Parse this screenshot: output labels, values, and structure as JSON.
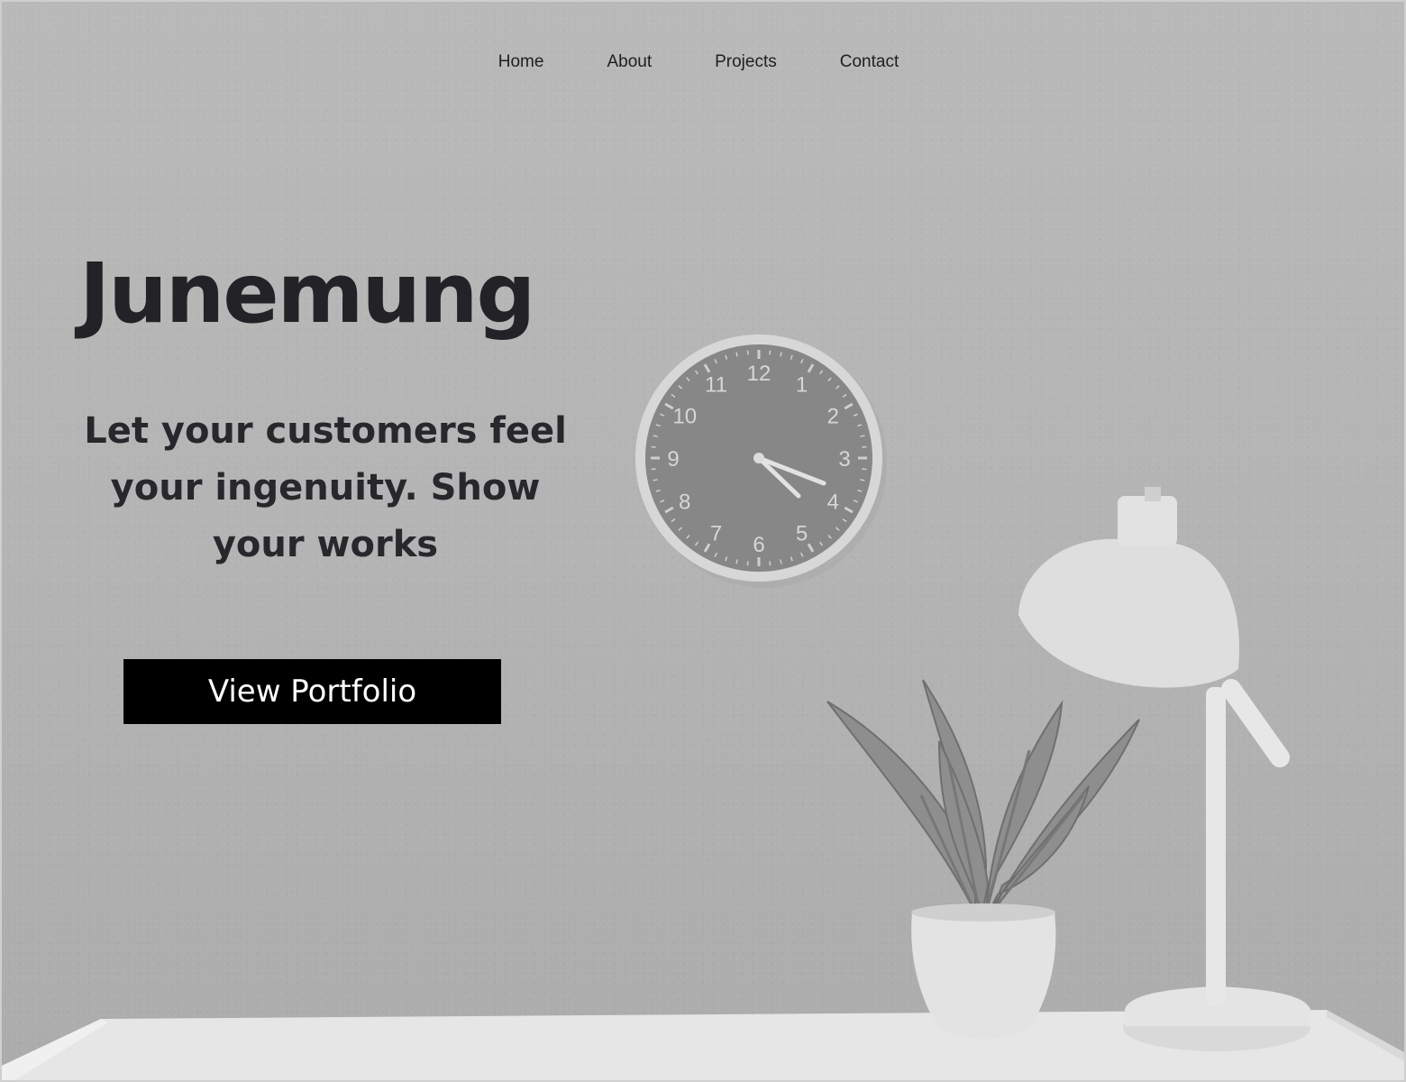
{
  "nav": {
    "items": [
      {
        "label": "Home"
      },
      {
        "label": "About"
      },
      {
        "label": "Projects"
      },
      {
        "label": "Contact"
      }
    ]
  },
  "hero": {
    "title": "Junemung",
    "subtitle": "Let your customers feel your ingenuity. Show your works",
    "cta_label": "View Portfolio"
  },
  "clock": {
    "numerals": [
      "12",
      "1",
      "2",
      "3",
      "4",
      "5",
      "6",
      "7",
      "8",
      "9",
      "10",
      "11"
    ]
  },
  "colors": {
    "cta_background": "#000000",
    "cta_text": "#ffffff",
    "title_text": "#232226"
  }
}
